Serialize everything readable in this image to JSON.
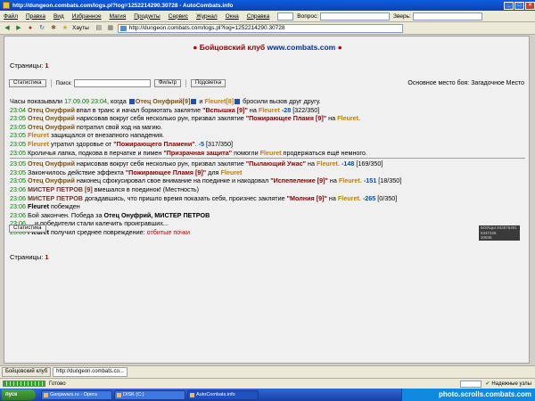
{
  "window": {
    "title": "http://dungeon.combats.com/logs.pl?log=1252214290.30728 - AutoCombats.info"
  },
  "menu": {
    "items": [
      "Файл",
      "Правка",
      "Вид",
      "Избранное",
      "Магия",
      "Продукты",
      "Сервис",
      "Журнал",
      "Окна",
      "Справка"
    ],
    "opponent_label": "Вопрос:",
    "animal_label": "Зверь:"
  },
  "toolbar": {
    "favorites_label": "Хауты",
    "address": "http://dungeon.combats.com/logs.pl?log=1252214290.30728"
  },
  "header": {
    "club": "Бойцовский клуб",
    "site": "www.combats.com"
  },
  "pages": {
    "label": "Страницы:",
    "current": "1"
  },
  "controls": {
    "stats_button": "Статистика",
    "search_label": "Поиск:",
    "filter_button": "Фильтр",
    "highlight_button": "Подсветка",
    "battle_place": "Основное место боя: Загадочное Место"
  },
  "log": {
    "intro": {
      "pre": "Часы показывали ",
      "time": "17.09.09 23:04",
      "mid": ", когда ",
      "p1": "Отец Онуфрий",
      "p1_level": "[9]",
      "and": " и ",
      "p2": "Fleuret",
      "p2_level": "[8]",
      "post": " бросили вызов друг другу."
    },
    "lines": [
      {
        "time": "23:04",
        "actor": "Отец Онуфрий",
        "actor_cls": "p1",
        "text": " впал в транс и начал бормотать заклятие ",
        "spell": "\"Вспышка [9]\"",
        "text2": " на ",
        "target": "Fleuret",
        "target_cls": "p2",
        "dmg": " -28",
        "hp": " [322/350]"
      },
      {
        "time": "23:05",
        "actor": "Отец Онуфрий",
        "actor_cls": "p1",
        "text": " нарисовав вокруг себя несколько рун, призвал заклятие ",
        "spell": "\"Пожирающее Пламя [9]\"",
        "text2": " на ",
        "target": "Fleuret.",
        "target_cls": "p2",
        "dmg": "",
        "hp": ""
      },
      {
        "time": "23:05",
        "actor": "Отец Онуфрий",
        "actor_cls": "p1",
        "text": " потратил свой ход на магию.",
        "spell": "",
        "text2": "",
        "target": "",
        "target_cls": "",
        "dmg": "",
        "hp": ""
      },
      {
        "time": "23:05",
        "actor": "Fleuret",
        "actor_cls": "p2",
        "text": " защищался от внезапного нападения.",
        "spell": "",
        "text2": "",
        "target": "",
        "target_cls": "",
        "dmg": "",
        "hp": ""
      },
      {
        "time": "23:05",
        "actor": "Fleuret",
        "actor_cls": "p2",
        "text": " утратил здоровье от ",
        "spell": "\"Пожирающего Пламени\"",
        "text2": ".",
        "target": "",
        "target_cls": "",
        "dmg": " -5",
        "hp": " [317/350]"
      },
      {
        "time": "23:05",
        "actor": "",
        "actor_cls": "",
        "text": "Кроличья лапка, подкова в перчатке и пимен ",
        "spell": "\"Призрачная защита\"",
        "text2": " помогли ",
        "target": "Fleuret",
        "target_cls": "p2",
        "dmg": "",
        "hp": " продержаться ещё немного."
      },
      {
        "sep": true
      },
      {
        "time": "23:05",
        "actor": "Отец Онуфрий",
        "actor_cls": "p1",
        "text": " нарисовав вокруг себя несколько рун, призвал заклятие ",
        "spell": "\"Пылающий Ужас\"",
        "text2": " на ",
        "target": "Fleuret.",
        "target_cls": "p2",
        "dmg": " -148",
        "hp": " [169/350]"
      },
      {
        "time": "23:05",
        "actor": "",
        "actor_cls": "",
        "text": "Закончилось действие эффекта ",
        "spell": "\"Пожирающее Пламя [9]\"",
        "text2": " для ",
        "target": "Fleuret",
        "target_cls": "p2",
        "dmg": "",
        "hp": ""
      },
      {
        "time": "23:05",
        "actor": "Отец Онуфрий",
        "actor_cls": "p1",
        "text": " наконец сфокусировал свое внимание на поединке и накодовал ",
        "spell": "\"Испепеление [9]\"",
        "text2": " на ",
        "target": "Fleuret.",
        "target_cls": "p2",
        "dmg": " -151",
        "hp": " [18/350]"
      },
      {
        "time": "23:06",
        "actor": "МИСТЕР ПЕТРОВ [9]",
        "actor_cls": "p3",
        "text": " вмешался в поединок! (Местность)",
        "spell": "",
        "text2": "",
        "target": "",
        "target_cls": "",
        "dmg": "",
        "hp": ""
      },
      {
        "time": "23:06",
        "actor": "МИСТЕР ПЕТРОВ",
        "actor_cls": "p3",
        "text": " догадавшись, что пришло время показать себя, произнес заклятие ",
        "spell": "\"Молния [9]\"",
        "text2": " на ",
        "target": "Fleuret.",
        "target_cls": "p2",
        "dmg": " -265",
        "hp": " [0/350]"
      },
      {
        "time": "23:06",
        "actor": "Fleuret",
        "actor_cls": "bold",
        "text": " побежден",
        "spell": "",
        "text2": "",
        "target": "",
        "target_cls": "",
        "dmg": "",
        "hp": ""
      },
      {
        "time": "23:06",
        "actor": "",
        "actor_cls": "",
        "text": "Бой закончен. Победа за ",
        "spell": "",
        "text2": "",
        "target": "Отец Онуфрий, МИСТЕР ПЕТРОВ",
        "target_cls": "bold",
        "dmg": "",
        "hp": ""
      },
      {
        "time": "23:06",
        "actor": "",
        "actor_cls": "",
        "text": "... и победители стали калечить проигравших...",
        "spell": "",
        "text2": "",
        "target": "",
        "target_cls": "",
        "dmg": "",
        "hp": ""
      },
      {
        "time": "23:06",
        "actor": "Fleuret",
        "actor_cls": "bold",
        "text": " получил среднее повреждение: ",
        "spell": "",
        "text2": "",
        "target": "отбитые почки",
        "target_cls": "red",
        "dmg": "",
        "hp": ""
      }
    ]
  },
  "counter": {
    "line1": "БОЙЦЫ 842576491",
    "line2": "5337226",
    "line3": "20935"
  },
  "tabs": [
    {
      "label": "Бойцовский клуб"
    },
    {
      "label": "http://dungeon.combats.co..."
    }
  ],
  "status": {
    "text": "Готово",
    "security": "Надежные узлы"
  },
  "taskbar": {
    "start": "пуск",
    "tasks": [
      "Ganjawars.ru - Opera",
      "DISK (C:)",
      "AutoCombats.info"
    ],
    "tray": "photo.scrolls.combats.com"
  },
  "colors": {
    "accent": "#8b0000",
    "site_link": "#0030a0",
    "time": "#008000",
    "damage": "#0050b0",
    "player1": "#7a5210",
    "player2": "#c08000"
  }
}
